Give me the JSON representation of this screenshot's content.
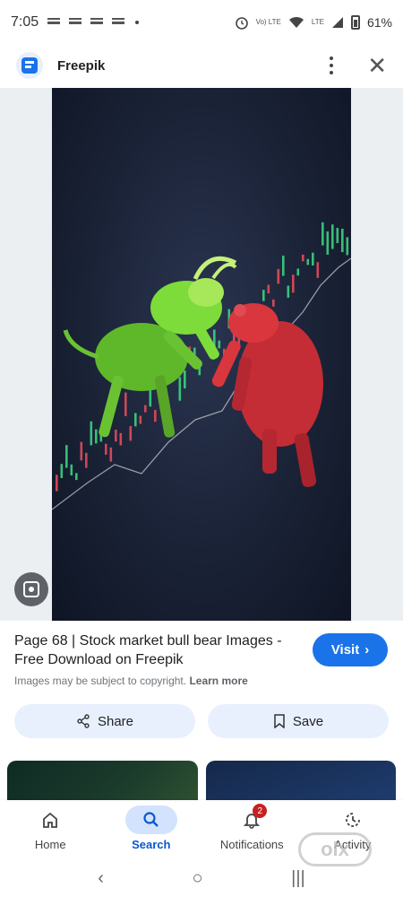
{
  "status_bar": {
    "time": "7:05",
    "network_lte_label": "Vo) LTE",
    "lte_label": "LTE",
    "battery": "61%"
  },
  "app_bar": {
    "title": "Freepik",
    "logo_icon": "freepik-logo-icon",
    "menu_icon": "more-vert-icon",
    "close_icon": "close-icon"
  },
  "result": {
    "title": "Page 68 | Stock market bull bear Images - Free Download on Freepik",
    "copyright_text": "Images may be subject to copyright.",
    "learn_more_label": "Learn more",
    "visit_label": "Visit",
    "visit_icon": "chevron-right-icon"
  },
  "actions": {
    "share_label": "Share",
    "share_icon": "share-icon",
    "save_label": "Save",
    "save_icon": "bookmark-icon"
  },
  "bottom_nav": [
    {
      "label": "Home",
      "icon": "home-icon",
      "active": false
    },
    {
      "label": "Search",
      "icon": "search-icon",
      "active": true
    },
    {
      "label": "Notifications",
      "icon": "bell-icon",
      "active": false,
      "badge": "2"
    },
    {
      "label": "Activity",
      "icon": "activity-icon",
      "active": false
    }
  ],
  "watermark": "olx",
  "colors": {
    "accent": "#1a73e8",
    "pill_bg": "#e8f0fe",
    "active_nav_bg": "#d3e3fd",
    "badge": "#c5221f",
    "bull_green": "#7ddc3a",
    "bear_red": "#d9363e",
    "chart_bg": "#1a2236"
  }
}
